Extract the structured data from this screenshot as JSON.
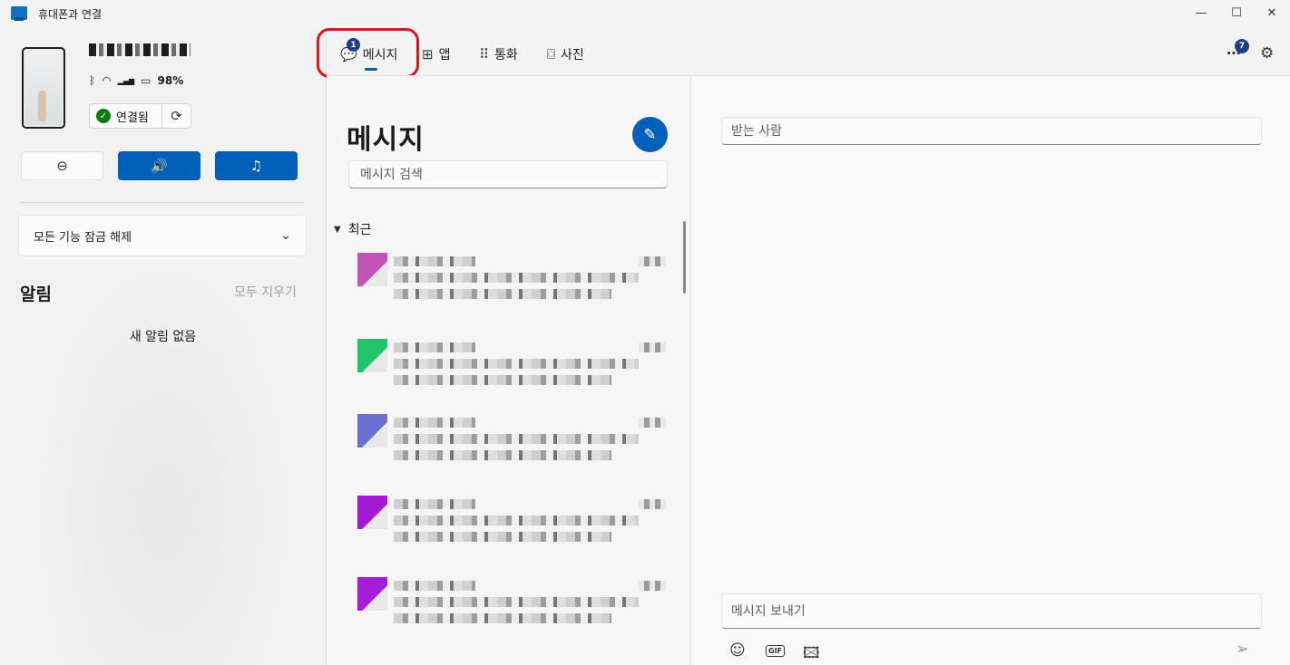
{
  "window": {
    "title": "휴대폰과 연결",
    "minimize": "—",
    "maximize": "☐",
    "close": "✕"
  },
  "device": {
    "battery": "98%",
    "status": "연결됨",
    "icons": {
      "bluetooth": "ᛒ",
      "wifi": "◠",
      "signal": "▂▄▆",
      "battery_icon": "▭"
    },
    "controls": [
      "⊖",
      "🔊",
      "♫"
    ]
  },
  "unlock": {
    "label": "모든 기능 잠금 해제",
    "chevron": "⌄"
  },
  "notifications": {
    "title": "알림",
    "clear_all": "모두 지우기",
    "empty": "새 알림 없음"
  },
  "tabs": [
    {
      "label": "메시지",
      "icon": "💬",
      "badge": "1"
    },
    {
      "label": "앱",
      "icon": "⊞"
    },
    {
      "label": "통화",
      "icon": "⠿"
    },
    {
      "label": "사진",
      "icon": "⌼"
    }
  ],
  "toolbar": {
    "more": "⋯",
    "more_badge": "7",
    "settings": "⚙"
  },
  "messages": {
    "title": "메시지",
    "search_placeholder": "메시지 검색",
    "section": "최근",
    "section_caret": "▼",
    "compose_icon": "✎",
    "avatar_colors": [
      "#c254b8",
      "#1fc46c",
      "#6b6fd1",
      "#a21ad6",
      "#a51cd9"
    ]
  },
  "compose": {
    "to_placeholder": "받는 사람",
    "message_placeholder": "메시지 보내기",
    "emoji_icon": "☺",
    "gif_label": "GIF",
    "image_icon": "🖾",
    "send_icon": "➢"
  }
}
